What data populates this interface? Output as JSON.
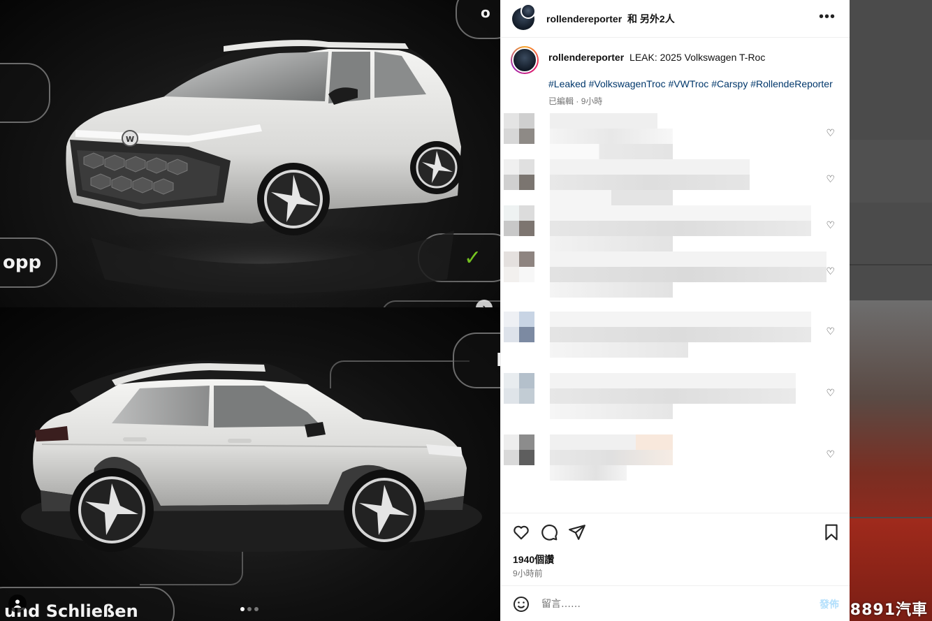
{
  "media": {
    "top_panel": {
      "pill_left_mid": "opp",
      "pill_right_mark": "✓",
      "pill_top_right": "o"
    },
    "bottom_panel": {
      "pill_bottom_left": "und Schließen",
      "pill_right": "F"
    },
    "next_label": "›",
    "carousel": {
      "count": 3,
      "active": 1
    }
  },
  "header": {
    "username": "rollendereporter",
    "coauthors": "和 另外2人",
    "more": "•••"
  },
  "caption": {
    "username": "rollendereporter",
    "text": "LEAK: 2025 Volkswagen T-Roc",
    "hashtags": "#Leaked #VolkswagenTroc #VWTroc #Carspy #RollendeReporter",
    "edited": "已編輯",
    "time": "9小時"
  },
  "actions": {
    "likes": "1940個讚",
    "posted": "9小時前"
  },
  "comment_box": {
    "placeholder": "留言……",
    "post_label": "發佈"
  },
  "watermark": "8891汽車",
  "colors": {
    "link": "#00376b",
    "muted": "#737373",
    "post_button": "#b2dffc",
    "check": "#7ed321"
  },
  "icons": [
    "heart-icon",
    "comment-icon",
    "share-icon",
    "bookmark-icon",
    "emoji-icon",
    "more-icon",
    "chevron-right-icon",
    "user-tag-icon"
  ]
}
